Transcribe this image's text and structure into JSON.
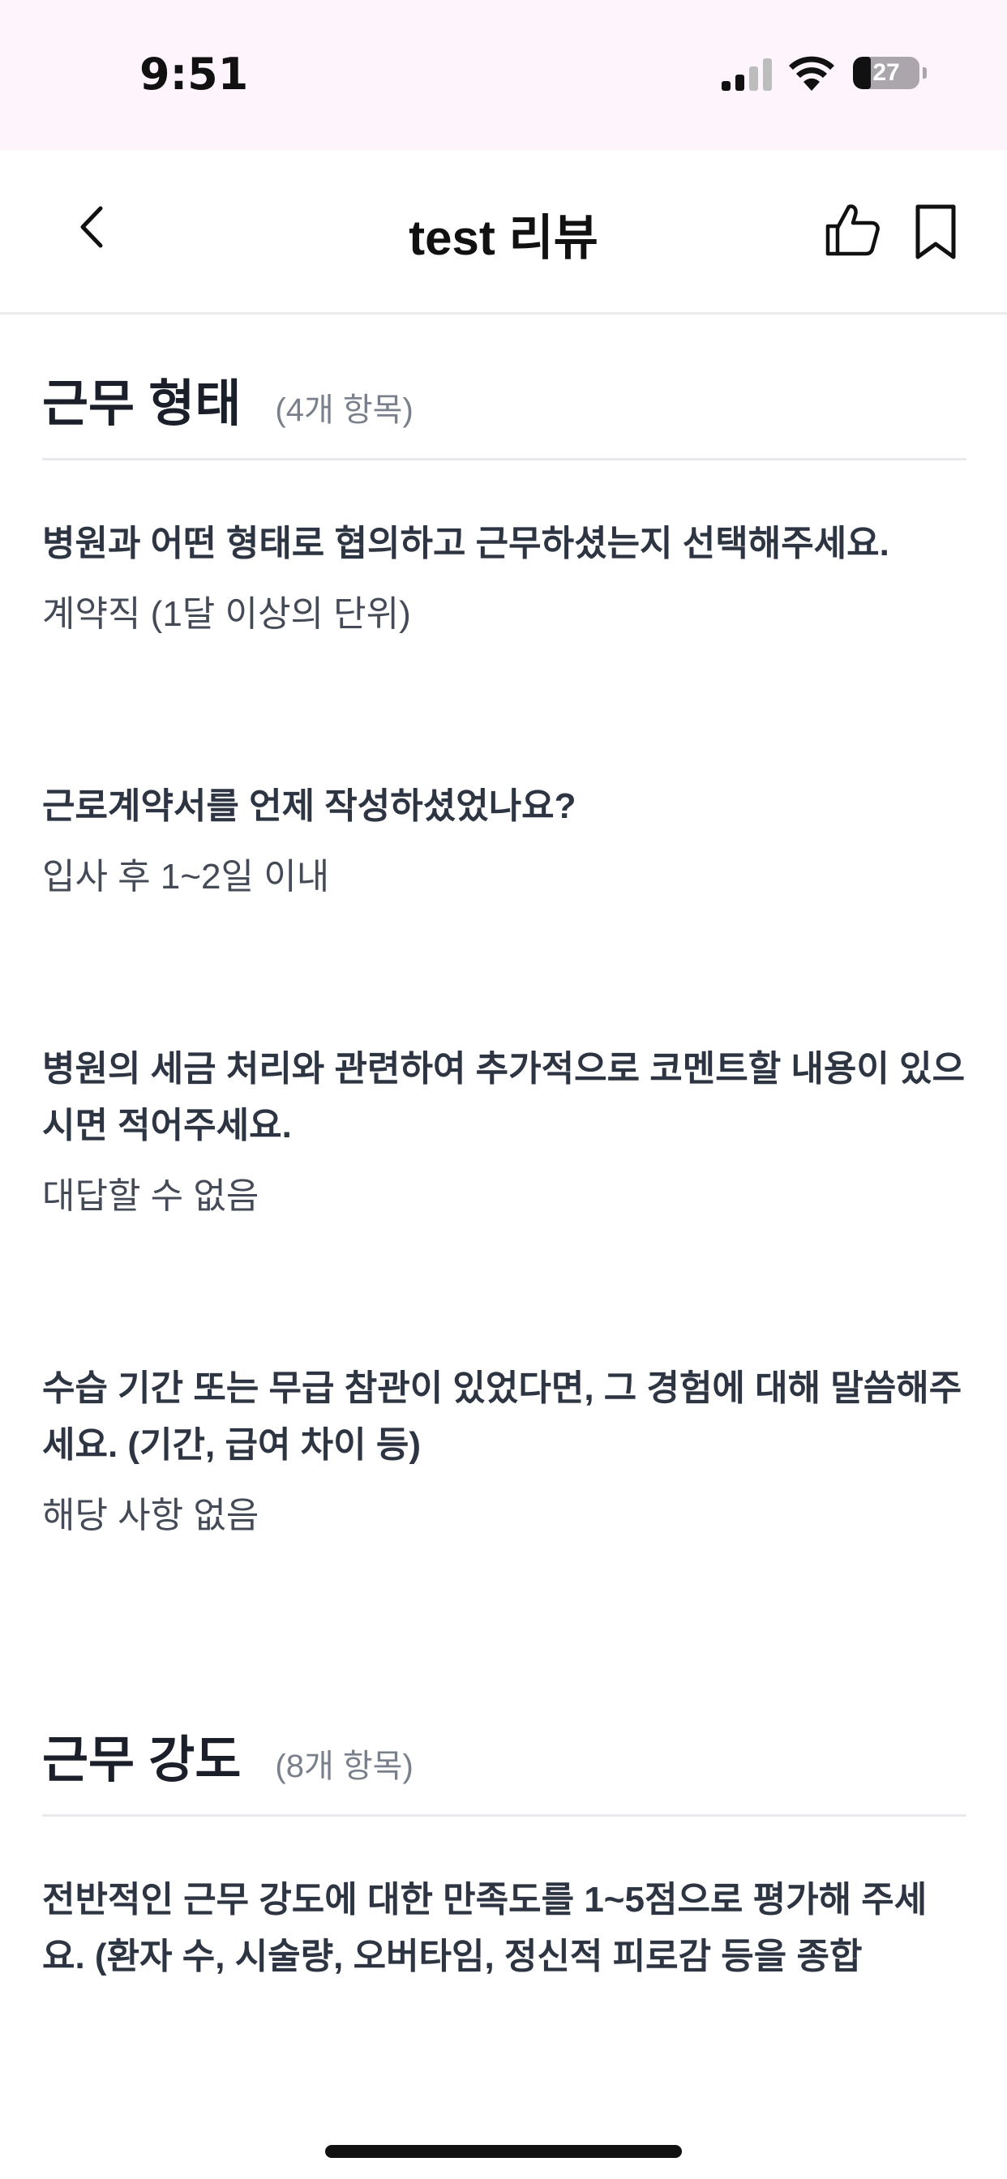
{
  "status_bar": {
    "time": "9:51",
    "battery_level": "27",
    "battery_fraction": 0.27
  },
  "nav": {
    "title": "test 리뷰",
    "back_icon": "chevron-left-icon",
    "like_icon": "thumbs-up-icon",
    "bookmark_icon": "bookmark-icon"
  },
  "sections": [
    {
      "title": "근무 형태",
      "count": "(4개 항목)",
      "items": [
        {
          "question": "병원과 어떤 형태로 협의하고 근무하셨는지 선택해주세요.",
          "answer": "계약직 (1달 이상의 단위)"
        },
        {
          "question": "근로계약서를 언제 작성하셨었나요?",
          "answer": "입사 후 1~2일 이내"
        },
        {
          "question": "병원의 세금 처리와 관련하여 추가적으로 코멘트할 내용이 있으시면 적어주세요.",
          "answer": "대답할 수 없음"
        },
        {
          "question": "수습 기간 또는 무급 참관이 있었다면, 그 경험에 대해 말씀해주세요. (기간, 급여 차이 등)",
          "answer": "해당 사항 없음"
        }
      ]
    },
    {
      "title": "근무 강도",
      "count": "(8개 항목)",
      "items": [
        {
          "question": "전반적인 근무 강도에 대한 만족도를 1~5점으로 평가해 주세요. (환자 수, 시술량, 오버타임, 정신적 피로감 등을 종합"
        }
      ]
    }
  ]
}
